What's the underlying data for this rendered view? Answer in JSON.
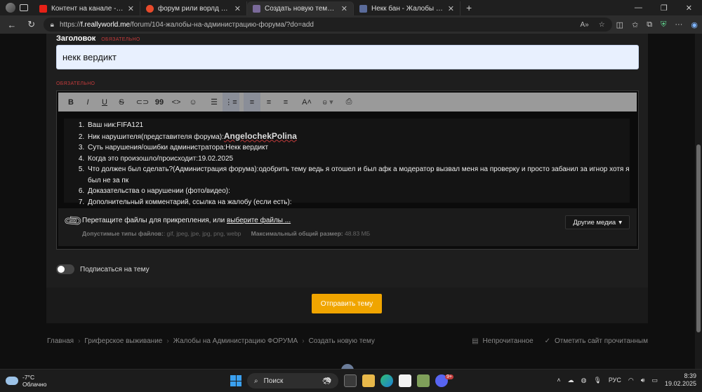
{
  "browser": {
    "tabs": [
      {
        "title": "Контент на канале - YouTube Studio",
        "favicon_color": "#e62117",
        "active": false
      },
      {
        "title": "форум рили ворлд — Яндекс: нашлось",
        "favicon_color": "#e84a2b",
        "active": false
      },
      {
        "title": "Создать новую тему - ReallyWorld",
        "favicon_color": "#7a6a9a",
        "active": true
      },
      {
        "title": "Некк бан - Жалобы на Администрацию",
        "favicon_color": "#5a6b9a",
        "active": false
      }
    ],
    "new_tab_label": "+",
    "url_scheme": "https://",
    "url_host": "f.reallyworld.me",
    "url_path": "/forum/104-жалобы-на-администрацию-форума/?do=add"
  },
  "form": {
    "title_label": "Заголовок",
    "required_label": "ОБЯЗАТЕЛЬНО",
    "title_value": "некк вердикт",
    "content_required_label": "ОБЯЗАТЕЛЬНО",
    "toolbar_icons": [
      "bold-icon",
      "italic-icon",
      "underline-icon",
      "strikethrough-icon",
      "link-icon",
      "quote-icon",
      "code-icon",
      "emoji-icon",
      "bullet-list-icon",
      "numbered-list-icon",
      "align-left-icon",
      "align-center-icon",
      "align-right-icon",
      "font-size-icon",
      "format-icon",
      "preview-icon"
    ],
    "content_items": [
      {
        "prefix": "Ваш ник:",
        "value": "FIFA121"
      },
      {
        "prefix": "Ник нарушителя(представителя форума):",
        "value": "AngelochekPolina"
      },
      {
        "prefix": "Суть нарушения/ошибки администратора:",
        "value": "Некк вердикт"
      },
      {
        "prefix": "Когда это произошло/происходит:",
        "value": "19.02.2025"
      },
      {
        "prefix": "Что должен был сделать?(Администрация форума):",
        "value": "одобрить тему ведь я отошел и был афк а модератор вызвал меня на проверку и просто забанил за игнор хотя я был не за пк"
      },
      {
        "prefix": "Доказательства о нарушении (фото/видео):",
        "value": ""
      },
      {
        "prefix": "Дополнительный комментарий, ссылка на жалобу (если есть):",
        "value": ""
      }
    ],
    "attach_text": "Перетащите файлы для прикрепления, или ",
    "attach_link": "выберите файлы ...",
    "allowed_types_label": "Допустимые типы файлов:",
    "allowed_types": ": gif, jpeg, jpe, jpg, png, webp",
    "max_size_label": "Максимальный общий размер:",
    "max_size": "48.83 МБ",
    "other_media": "Другие медиа",
    "subscribe_label": "Подписаться на тему",
    "subscribe_on": false,
    "submit_label": "Отправить тему"
  },
  "breadcrumb": [
    "Главная",
    "Гриферское выживание",
    "Жалобы на Администрацию ФОРУМА",
    "Создать новую тему"
  ],
  "footer_links": {
    "unread": "Непрочитанное",
    "mark_read": "Отметить сайт прочитанным"
  },
  "taskbar": {
    "temp": "-7°C",
    "weather": "Облачно",
    "search_placeholder": "Поиск",
    "lang": "РУС",
    "time": "8:39",
    "date": "19.02.2025",
    "discord_badge": "9+"
  },
  "colors": {
    "accent": "#f0a500",
    "required": "#c23b3b"
  }
}
